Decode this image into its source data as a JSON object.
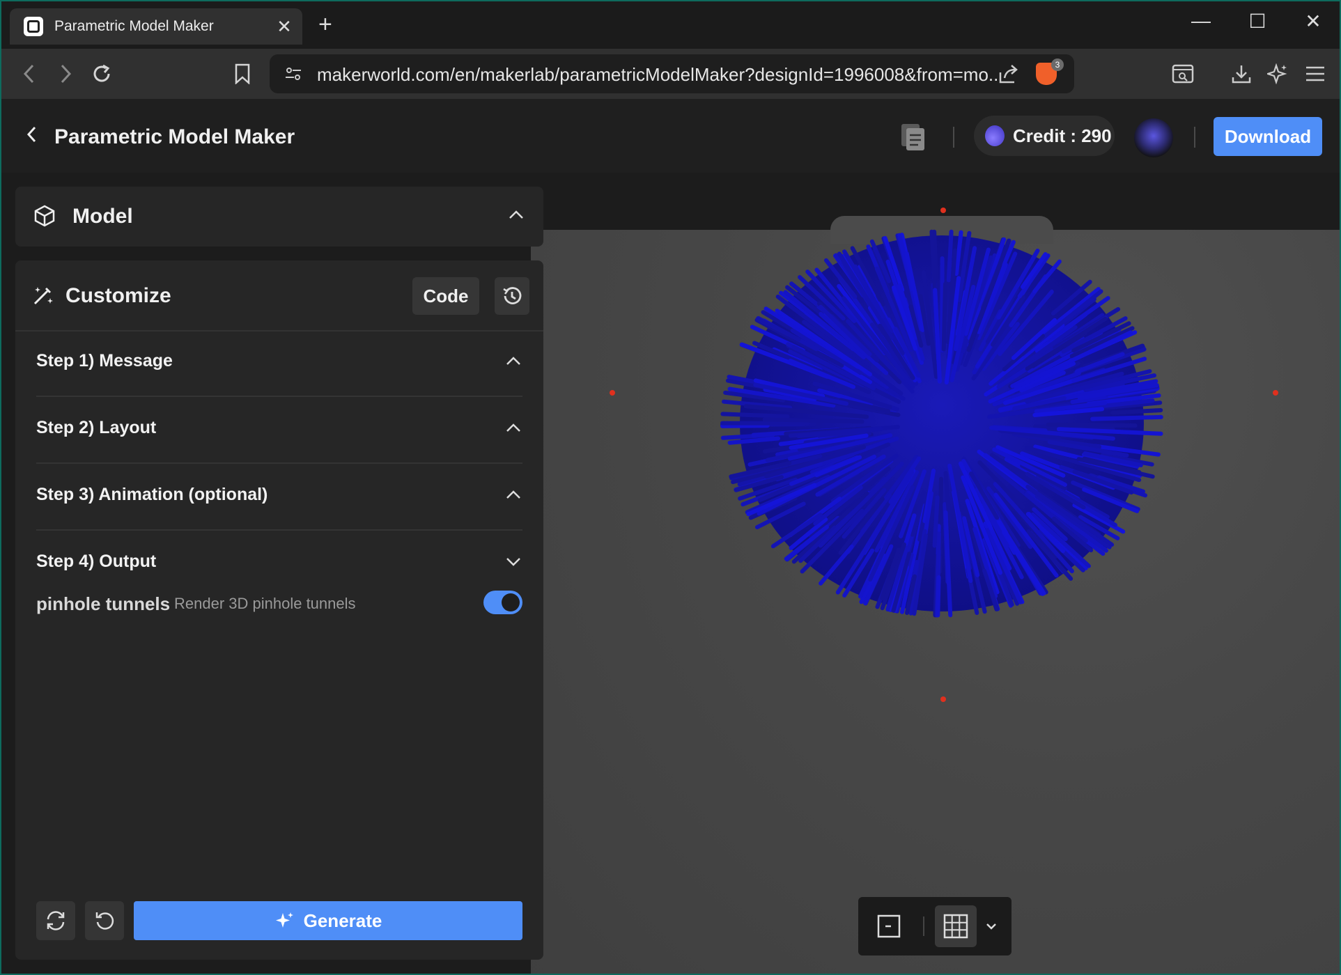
{
  "browser": {
    "tab_title": "Parametric Model Maker",
    "tab_close": "✕",
    "new_tab": "+",
    "url": "makerworld.com/en/makerlab/parametricModelMaker?designId=1996008&from=mo...",
    "shield_count": "3",
    "controls": {
      "minimize": "—",
      "maximize": "☐",
      "close": "✕"
    }
  },
  "header": {
    "title": "Parametric Model Maker",
    "credit_label": "Credit : 290",
    "download_label": "Download"
  },
  "panel": {
    "model_label": "Model",
    "customize_label": "Customize",
    "code_label": "Code",
    "steps": [
      {
        "label": "Step 1) Message",
        "expanded": false
      },
      {
        "label": "Step 2) Layout",
        "expanded": false
      },
      {
        "label": "Step 3) Animation (optional)",
        "expanded": false
      },
      {
        "label": "Step 4) Output",
        "expanded": true
      }
    ],
    "option": {
      "name": "pinhole tunnels",
      "description": "Render 3D pinhole tunnels",
      "enabled": true
    },
    "generate_label": "Generate"
  },
  "colors": {
    "accent": "#4f8ef7",
    "model_blue": "#1515a8",
    "marker_red": "#e0301e"
  },
  "icons": {
    "back": "chevron-left-icon",
    "forward": "chevron-right-icon",
    "reload": "reload-icon",
    "bookmark": "bookmark-icon",
    "site_settings": "tune-icon",
    "share": "share-icon",
    "brave": "brave-shield-icon",
    "reader": "reader-mode-icon",
    "downloads": "download-icon",
    "leo": "sparkle-icon",
    "menu": "hamburger-icon"
  }
}
